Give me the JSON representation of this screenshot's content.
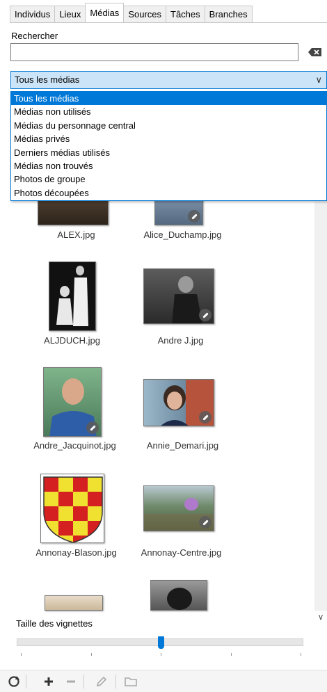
{
  "tabs": [
    "Individus",
    "Lieux",
    "Médias",
    "Sources",
    "Tâches",
    "Branches"
  ],
  "active_tab": "Médias",
  "search": {
    "label": "Rechercher",
    "value": ""
  },
  "filter": {
    "selected": "Tous les médias",
    "options": [
      "Tous les médias",
      "Médias non utilisés",
      "Médias du personnage central",
      "Médias privés",
      "Derniers médias utilisés",
      "Médias non trouvés",
      "Photos de groupe",
      "Photos découpées"
    ]
  },
  "media": [
    {
      "name": "ALEX.jpg"
    },
    {
      "name": "Alice_Duchamp.jpg"
    },
    {
      "name": "ALJDUCH.jpg"
    },
    {
      "name": "Andre J.jpg"
    },
    {
      "name": "Andre_Jacquinot.jpg"
    },
    {
      "name": "Annie_Demari.jpg"
    },
    {
      "name": "Annonay-Blason.jpg"
    },
    {
      "name": "Annonay-Centre.jpg"
    }
  ],
  "thumbnail_size": {
    "label": "Taille des vignettes",
    "level": 0.5
  },
  "colors": {
    "accent": "#0078d7",
    "select_bg": "#cce4f7"
  },
  "toolbar_icons": [
    "refresh-icon",
    "add-icon",
    "remove-icon",
    "edit-icon",
    "folder-icon"
  ]
}
